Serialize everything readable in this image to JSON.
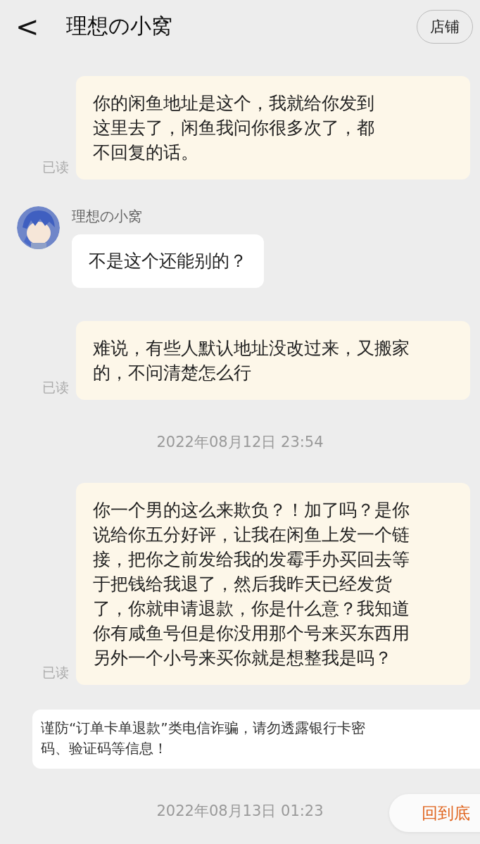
{
  "header": {
    "back": "<",
    "title": "理想の小窝",
    "shop_button": "店铺"
  },
  "messages": [
    {
      "kind": "sent",
      "text": "你的闲鱼地址是这个，我就给你发到这里去了，闲鱼我问你很多次了，都不回复的话。",
      "read_label": "已读"
    },
    {
      "kind": "received",
      "sender": "理想の小窝",
      "text": "不是这个还能别的？"
    },
    {
      "kind": "sent",
      "text": "难说，有些人默认地址没改过来，又搬家的，不问清楚怎么行",
      "read_label": "已读"
    },
    {
      "kind": "time",
      "text": "2022年08月12日 23:54"
    },
    {
      "kind": "sent",
      "text": "你一个男的这么来欺负？！加了吗？是你说给你五分好评，让我在闲鱼上发一个链接，把你之前发给我的发霉手办买回去等于把钱给我退了，然后我昨天已经发货了，你就申请退款，你是什么意？我知道你有咸鱼号但是你没用那个号来买东西用另外一个小号来买你就是想整我是吗？",
      "read_label": "已读"
    },
    {
      "kind": "notice",
      "text": "谨防“订单卡单退款”类电信诈骗，请勿透露银行卡密码、验证码等信息！"
    },
    {
      "kind": "time",
      "text": "2022年08月13日 01:23"
    }
  ],
  "scroll_bottom_button": "回到底"
}
